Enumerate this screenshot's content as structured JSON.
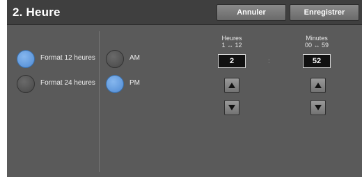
{
  "header": {
    "title": "2. Heure",
    "cancel_label": "Annuler",
    "save_label": "Enregistrer"
  },
  "format": {
    "options": [
      {
        "label": "Format 12 heures",
        "selected": true
      },
      {
        "label": "Format 24 heures",
        "selected": false
      }
    ]
  },
  "ampm": {
    "options": [
      {
        "label": "AM",
        "selected": false
      },
      {
        "label": "PM",
        "selected": true
      }
    ]
  },
  "hours": {
    "label": "Heures",
    "range": "1 ↔ 12",
    "value": "2"
  },
  "minutes": {
    "label": "Minutes",
    "range": "00 ↔ 59",
    "value": "52"
  },
  "separator": ":",
  "colors": {
    "selected": "#5b95dc",
    "unselected": "#4d4d4d",
    "background": "#5a5a5a",
    "titlebar": "#3f3f3f"
  }
}
